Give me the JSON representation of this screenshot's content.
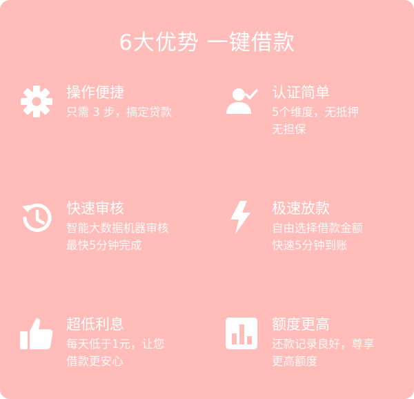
{
  "header": {
    "title": "6大优势  一键借款"
  },
  "features": [
    {
      "icon": "gear-icon",
      "title": "操作便捷",
      "desc": [
        "只需 3 步，搞定贷款"
      ]
    },
    {
      "icon": "user-check-icon",
      "title": "认证简单",
      "desc": [
        "5个维度，无抵押",
        "无担保"
      ]
    },
    {
      "icon": "history-clock-icon",
      "title": "快速审核",
      "desc": [
        "智能大数据机器审核",
        "最快5分钟完成"
      ]
    },
    {
      "icon": "lightning-icon",
      "title": "极速放款",
      "desc": [
        "自由选择借款金额",
        "快速5分钟到账"
      ]
    },
    {
      "icon": "thumbs-up-icon",
      "title": "超低利息",
      "desc": [
        "每天低于1元，让您",
        "借款更安心"
      ]
    },
    {
      "icon": "bar-chart-icon",
      "title": "额度更高",
      "desc": [
        "还款记录良好，尊享",
        "更高额度"
      ]
    }
  ]
}
